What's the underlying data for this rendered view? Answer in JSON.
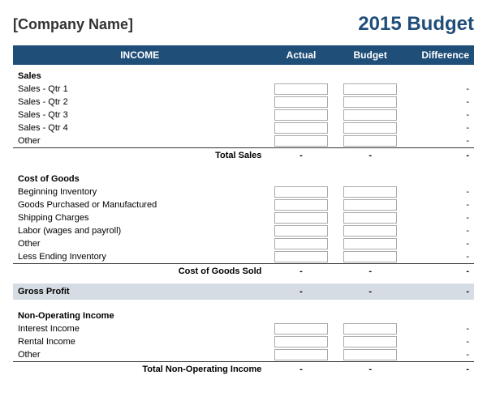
{
  "header": {
    "company_name": "[Company Name]",
    "budget_title": "2015 Budget"
  },
  "columns": {
    "income": "INCOME",
    "actual": "Actual",
    "budget": "Budget",
    "difference": "Difference"
  },
  "sections": {
    "sales": {
      "title": "Sales",
      "items": [
        "Sales - Qtr 1",
        "Sales - Qtr 2",
        "Sales - Qtr 3",
        "Sales - Qtr 4",
        "Other"
      ],
      "total_label": "Total Sales",
      "total_actual": "-",
      "total_budget": "-",
      "total_diff": "-"
    },
    "cogs": {
      "title": "Cost of Goods",
      "items": [
        "Beginning Inventory",
        "Goods Purchased or Manufactured",
        "Shipping Charges",
        "Labor (wages and payroll)",
        "Other",
        "Less Ending Inventory"
      ],
      "total_label": "Cost of Goods Sold",
      "total_actual": "-",
      "total_budget": "-",
      "total_diff": "-"
    },
    "gross_profit": {
      "label": "Gross Profit",
      "actual": "-",
      "budget": "-",
      "diff": "-"
    },
    "non_operating": {
      "title": "Non-Operating Income",
      "items": [
        "Interest Income",
        "Rental Income",
        "Other"
      ],
      "total_label": "Total Non-Operating Income",
      "total_actual": "-",
      "total_budget": "-",
      "total_diff": "-"
    }
  }
}
